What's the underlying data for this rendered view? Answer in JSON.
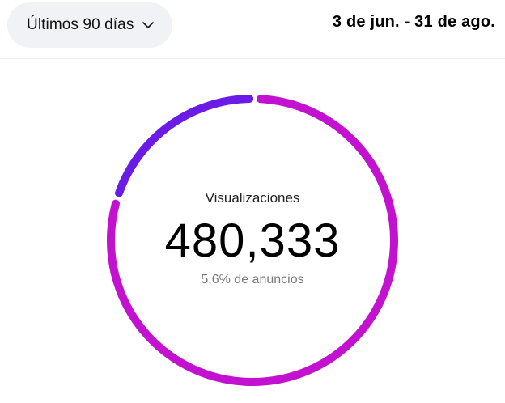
{
  "filter": {
    "range_label": "Últimos 90 días",
    "chevron_icon": "chevron-down-icon"
  },
  "date_range": "3 de jun. - 31 de ago.",
  "metric": {
    "label": "Visualizaciones",
    "value": "480,333",
    "sub_label": "5,6% de anuncios"
  },
  "donut": {
    "segments": [
      {
        "name": "anuncios",
        "share": 0.056,
        "color": "#6a1ce6"
      },
      {
        "name": "orgánico",
        "share": 0.944,
        "color": "#c312cf"
      }
    ]
  },
  "colors": {
    "ads": "#6a1ce6",
    "organic": "#c312cf",
    "chip_bg": "#f1f2f5",
    "muted_text": "#7a7a7a"
  }
}
